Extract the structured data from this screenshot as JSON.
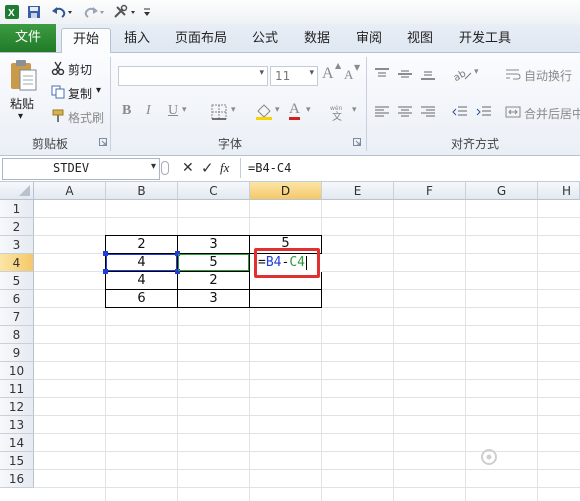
{
  "quick_access": {
    "save": "save-icon",
    "undo": "undo-icon",
    "redo": "redo-icon",
    "customize": "tools-icon"
  },
  "tabs": [
    "文件",
    "开始",
    "插入",
    "页面布局",
    "公式",
    "数据",
    "审阅",
    "视图",
    "开发工具"
  ],
  "active_tab": "开始",
  "clipboard": {
    "paste": "粘贴",
    "cut": "剪切",
    "copy": "复制",
    "format_painter": "格式刷",
    "group": "剪贴板"
  },
  "font": {
    "size": "11",
    "grow": "A",
    "shrink": "A",
    "bold": "B",
    "italic": "I",
    "underline": "U",
    "font_color": "A",
    "group": "字体"
  },
  "alignment": {
    "wrap_text": "自动换行",
    "merge_center": "合并后居中",
    "group": "对齐方式"
  },
  "formula_bar": {
    "name_box": "STDEV",
    "cancel": "✕",
    "enter": "✓",
    "fx": "fx",
    "formula": "=B4-C4"
  },
  "columns": [
    "A",
    "B",
    "C",
    "D",
    "E",
    "F",
    "G",
    "H"
  ],
  "rows": [
    "1",
    "2",
    "3",
    "4",
    "5",
    "6",
    "7",
    "8",
    "9",
    "10",
    "11",
    "12",
    "13",
    "14",
    "15",
    "16"
  ],
  "table": {
    "b3": "2",
    "c3": "3",
    "d3": "5",
    "b4": "4",
    "c4": "5",
    "d4": "=B4-C4",
    "b5": "4",
    "c5": "2",
    "d5": "",
    "b6": "6",
    "c6": "3",
    "d6": ""
  },
  "colors": {
    "file_tab": "#217a28",
    "highlight_box": "#e03030",
    "ref_b4": "#1f3fd6",
    "ref_c4": "#2e9b3a"
  }
}
